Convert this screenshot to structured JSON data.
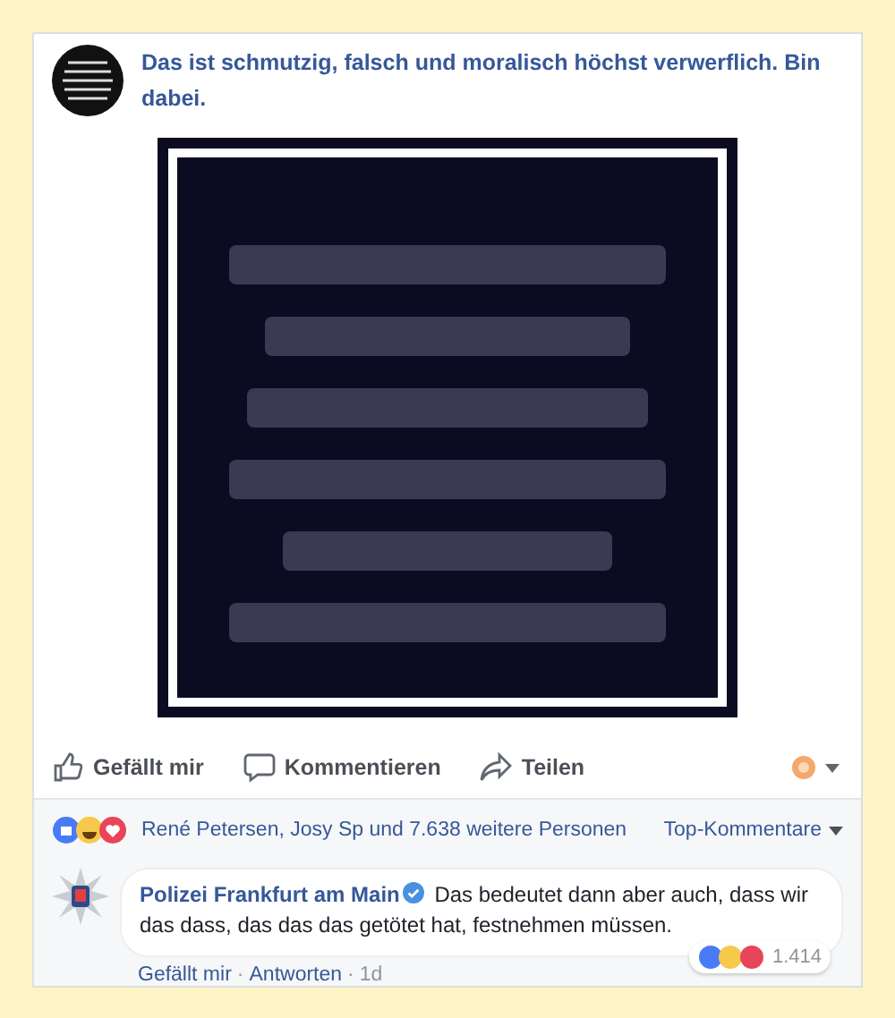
{
  "post": {
    "text": "Das ist schmutzig, falsch und moralisch höchst verwerflich. Bin dabei."
  },
  "actions": [
    {
      "kind": "like",
      "label": "Gefällt mir"
    },
    {
      "kind": "comment",
      "label": "Kommentieren"
    },
    {
      "kind": "share",
      "label": "Teilen"
    }
  ],
  "reactions": {
    "summary": "René Petersen, Josy Sp und 7.638 weitere Personen",
    "sort": "Top-Kommentare"
  },
  "comment": {
    "author": "Polizei Frankfurt am Main",
    "verified": true,
    "text": "Das bedeutet dann aber auch, dass wir das dass, das das das getötet hat, festnehmen müssen.",
    "reaction_count": "1.414",
    "links": [
      "Gefällt mir",
      "Antworten"
    ],
    "separator": "·",
    "time": "1d"
  }
}
